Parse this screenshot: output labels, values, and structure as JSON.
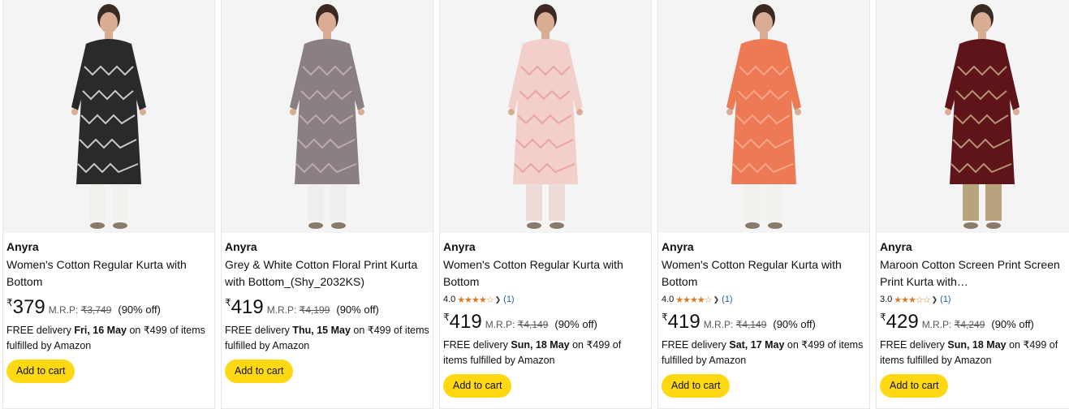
{
  "products": [
    {
      "brand": "Anyra",
      "title": "Women's Cotton Regular Kurta with Bottom",
      "rating": null,
      "currency": "₹",
      "price": "379",
      "mrp_label": "M.R.P:",
      "mrp": "₹3,749",
      "discount": "(90% off)",
      "delivery_prefix": "FREE delivery ",
      "delivery_date": "Fri, 16 May",
      "delivery_suffix": " on ₹499 of items fulfilled by Amazon",
      "cart_label": "Add to cart",
      "colors": {
        "kurta": "#2a2a2a",
        "pattern": "#f1f1f1",
        "bottom": "#f3f1ee"
      }
    },
    {
      "brand": "Anyra",
      "title": "Grey & White Cotton Floral Print Kurta with Bottom_(Shy_2032KS)",
      "rating": null,
      "currency": "₹",
      "price": "419",
      "mrp_label": "M.R.P:",
      "mrp": "₹4,199",
      "discount": "(90% off)",
      "delivery_prefix": "FREE delivery ",
      "delivery_date": "Thu, 15 May",
      "delivery_suffix": " on ₹499 of items fulfilled by Amazon",
      "cart_label": "Add to cart",
      "colors": {
        "kurta": "#8a7f82",
        "pattern": "#c9b6bb",
        "bottom": "#f0eeec"
      }
    },
    {
      "brand": "Anyra",
      "title": "Women's Cotton Regular Kurta with Bottom",
      "rating": {
        "value": "4.0",
        "stars": "★★★★☆",
        "count": "(1)"
      },
      "currency": "₹",
      "price": "419",
      "mrp_label": "M.R.P:",
      "mrp": "₹4,149",
      "discount": "(90% off)",
      "delivery_prefix": "FREE delivery ",
      "delivery_date": "Sun, 18 May",
      "delivery_suffix": " on ₹499 of items fulfilled by Amazon",
      "cart_label": "Add to cart",
      "colors": {
        "kurta": "#f2cfcb",
        "pattern": "#e89a95",
        "bottom": "#ecdcd8"
      }
    },
    {
      "brand": "Anyra",
      "title": "Women's Cotton Regular Kurta with Bottom",
      "rating": {
        "value": "4.0",
        "stars": "★★★★☆",
        "count": "(1)"
      },
      "currency": "₹",
      "price": "419",
      "mrp_label": "M.R.P:",
      "mrp": "₹4,149",
      "discount": "(90% off)",
      "delivery_prefix": "FREE delivery ",
      "delivery_date": "Sat, 17 May",
      "delivery_suffix": " on ₹499 of items fulfilled by Amazon",
      "cart_label": "Add to cart",
      "colors": {
        "kurta": "#ee7a55",
        "pattern": "#f5b29a",
        "bottom": "#f3f1ee"
      }
    },
    {
      "brand": "Anyra",
      "title": "Maroon Cotton Screen Print Screen Print Kurta with…",
      "rating": {
        "value": "3.0",
        "stars": "★★★☆☆",
        "count": "(1)"
      },
      "currency": "₹",
      "price": "429",
      "mrp_label": "M.R.P:",
      "mrp": "₹4,249",
      "discount": "(90% off)",
      "delivery_prefix": "FREE delivery ",
      "delivery_date": "Sun, 18 May",
      "delivery_suffix": " on ₹499 of items fulfilled by Amazon",
      "cart_label": "Add to cart",
      "colors": {
        "kurta": "#5e1418",
        "pattern": "#c9b38a",
        "bottom": "#b7a37c"
      }
    }
  ],
  "theme": {
    "star_color": "#de7921",
    "button_color": "#ffd814",
    "link_color": "#2162a1"
  }
}
